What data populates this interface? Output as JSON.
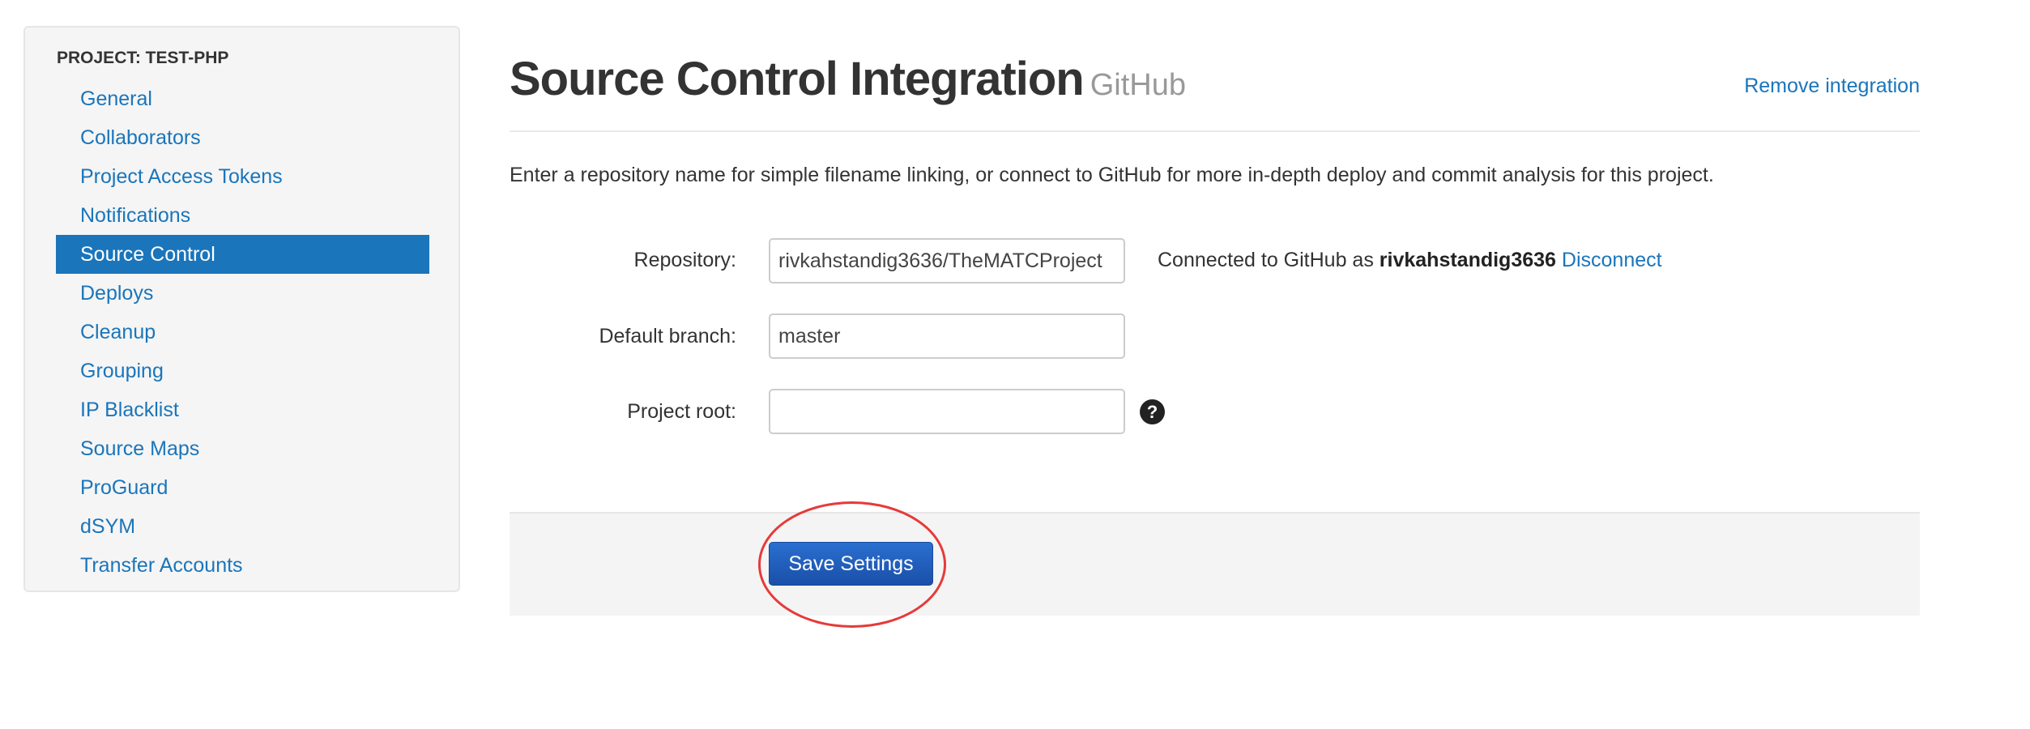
{
  "sidebar": {
    "heading": "PROJECT: TEST-PHP",
    "items": [
      {
        "label": "General"
      },
      {
        "label": "Collaborators"
      },
      {
        "label": "Project Access Tokens"
      },
      {
        "label": "Notifications"
      },
      {
        "label": "Source Control",
        "active": true
      },
      {
        "label": "Deploys"
      },
      {
        "label": "Cleanup"
      },
      {
        "label": "Grouping"
      },
      {
        "label": "IP Blacklist"
      },
      {
        "label": "Source Maps"
      },
      {
        "label": "ProGuard"
      },
      {
        "label": "dSYM"
      },
      {
        "label": "Transfer Accounts"
      }
    ]
  },
  "header": {
    "title": "Source Control Integration",
    "subtitle": "GitHub",
    "remove_link": "Remove integration"
  },
  "description": "Enter a repository name for simple filename linking, or connect to GitHub for more in-depth deploy and commit analysis for this project.",
  "form": {
    "repository": {
      "label": "Repository:",
      "value": "rivkahstandig3636/TheMATCProject"
    },
    "default_branch": {
      "label": "Default branch:",
      "value": "master"
    },
    "project_root": {
      "label": "Project root:",
      "value": ""
    },
    "connection": {
      "prefix": "Connected to GitHub as",
      "user": "rivkahstandig3636",
      "disconnect": "Disconnect"
    },
    "help_icon": "?"
  },
  "footer": {
    "save_label": "Save Settings"
  },
  "colors": {
    "accent": "#1a75bb",
    "annotation": "#e63a3a"
  }
}
